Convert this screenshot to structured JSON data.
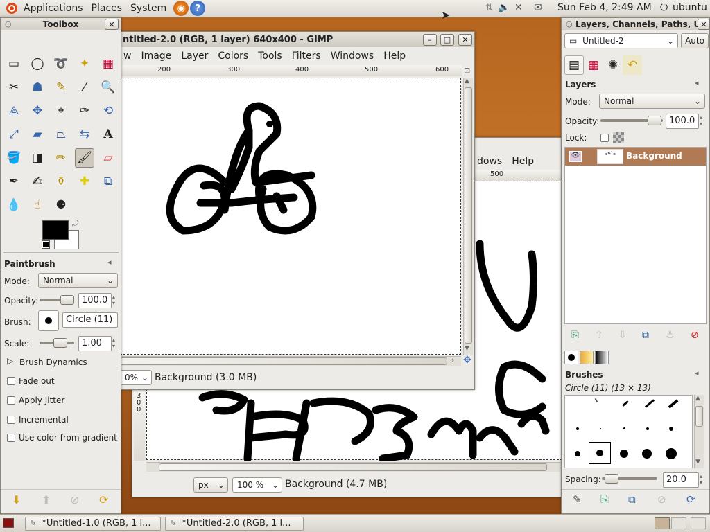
{
  "top_panel": {
    "menus": [
      "Applications",
      "Places",
      "System"
    ],
    "clock": "Sun Feb  4,  2:49 AM",
    "user": "ubuntu"
  },
  "toolbox": {
    "title": "Toolbox",
    "tool_options_title": "Paintbrush",
    "mode_label": "Mode:",
    "mode_value": "Normal",
    "opacity_label": "Opacity:",
    "opacity_value": "100.0",
    "opacity_level": 1.0,
    "brush_label": "Brush:",
    "brush_value": "Circle (11)",
    "scale_label": "Scale:",
    "scale_value": "1.00",
    "brush_dynamics": "Brush Dynamics",
    "checkboxes": [
      "Fade out",
      "Apply Jitter",
      "Incremental",
      "Use color from gradient"
    ],
    "fg_color": "#000000",
    "bg_color": "#ffffff"
  },
  "gimp_front": {
    "title": "ntitled-2.0 (RGB, 1 layer) 640x400 - GIMP",
    "menus": [
      "w",
      "Image",
      "Layer",
      "Colors",
      "Tools",
      "Filters",
      "Windows",
      "Help"
    ],
    "ruler_ticks": [
      "200",
      "300",
      "400",
      "500",
      "600"
    ],
    "zoom": "0%",
    "status": "Background (3.0 MB)"
  },
  "gimp_back": {
    "menus": [
      "dows",
      "Help"
    ],
    "ruler_ticks": [
      "500"
    ],
    "unit": "px",
    "zoom": "100 %",
    "status": "Background (4.7 MB)",
    "vruler_ticks": [
      "3",
      "0",
      "0"
    ]
  },
  "layers_dock": {
    "title": "Layers, Channels, Paths, U",
    "image_select": "Untitled-2",
    "auto_label": "Auto",
    "layers_title": "Layers",
    "mode_label": "Mode:",
    "mode_value": "Normal",
    "opacity_label": "Opacity:",
    "opacity_value": "100.0",
    "opacity_level": 1.0,
    "lock_label": "Lock:",
    "layer_name": "Background",
    "brushes_title": "Brushes",
    "brush_info": "Circle (11) (13 × 13)",
    "spacing_label": "Spacing:",
    "spacing_value": "20.0",
    "spacing_level": 0.2
  },
  "taskbar": {
    "items": [
      "*Untitled-1.0 (RGB, 1 l...",
      "*Untitled-2.0 (RGB, 1 l..."
    ]
  },
  "colors": {
    "accent": "#b8896a",
    "selection": "#b07a55"
  }
}
